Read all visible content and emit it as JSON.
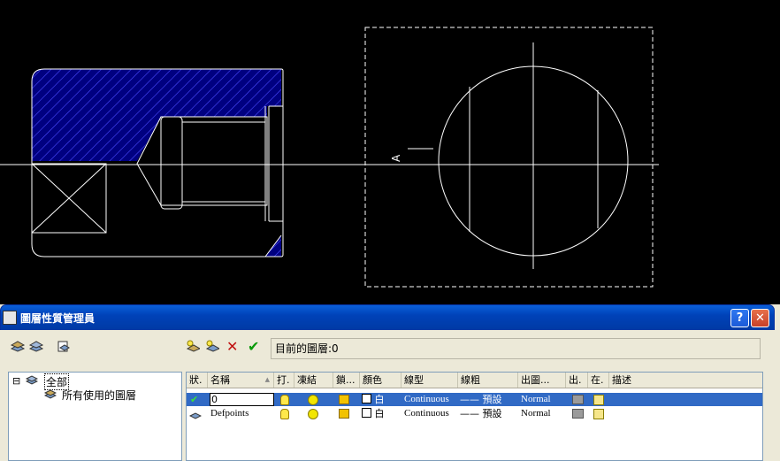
{
  "window": {
    "title": "圖層性質管理員",
    "help_label": "?",
    "close_label": "✕"
  },
  "toolbar": {
    "left_icons": [
      "new-property-filter-icon",
      "new-group-filter-icon",
      "layer-states-manager-icon"
    ],
    "right_icons": [
      "new-layer-icon",
      "new-layer-frozen-icon",
      "delete-layer-icon",
      "set-current-icon"
    ],
    "delete_glyph": "✕",
    "set_current_glyph": "✔"
  },
  "current_layer": {
    "label": "目前的圖層:",
    "value": "0"
  },
  "tree": {
    "expand_glyph": "⊟",
    "root": "全部",
    "child": "所有使用的圖層"
  },
  "columns": [
    "狀.",
    "名稱",
    "打.",
    "凍結",
    "鎖...",
    "顏色",
    "線型",
    "線粗",
    "出圖...",
    "出.",
    "在.",
    "描述"
  ],
  "sort_glyph": "▲",
  "layers": [
    {
      "status": "✔",
      "name": "0",
      "color_name": "白",
      "linetype": "Continuous",
      "lineweight": "—— 預設",
      "plot_style": "Normal",
      "selected": true
    },
    {
      "status": "",
      "name": "Defpoints",
      "color_name": "白",
      "linetype": "Continuous",
      "lineweight": "—— 預設",
      "plot_style": "Normal",
      "selected": false
    }
  ],
  "drawing": {
    "view_label": "A"
  }
}
